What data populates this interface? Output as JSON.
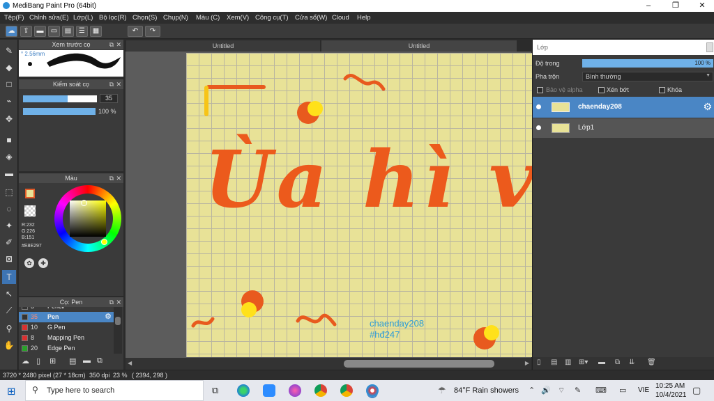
{
  "window": {
    "title": "MediBang Paint Pro (64bit)",
    "minimize": "–",
    "maximize": "❐",
    "close": "✕"
  },
  "menu": [
    "Tệp(F)",
    "Chỉnh sửa(E)",
    "Lớp(L)",
    "Bộ lọc(R)",
    "Chọn(S)",
    "Chụp(N)",
    "Màu (C)",
    "Xem(V)",
    "Công cụ(T)",
    "Cửa sổ(W)",
    "Cloud",
    "Help"
  ],
  "tabs": [
    "Untitled",
    "Untitled"
  ],
  "brush_preview": {
    "title": "Xem trước cọ",
    "size": "2.56mm"
  },
  "brush_control": {
    "title": "Kiểm soát cọ",
    "size_value": "35",
    "opacity_value": "100 %",
    "size_fraction": 0.35,
    "opacity_fraction": 1.0
  },
  "color": {
    "title": "Màu",
    "r": "R:232",
    "g": "G:226",
    "b": "B:151",
    "hex": "#E8E297",
    "swatch": "#e8e297",
    "primary": "#e8e297"
  },
  "brush_list": {
    "title": "Cọ: Pen",
    "items": [
      {
        "size": "3",
        "name": "Pencil",
        "color": "#333333"
      },
      {
        "size": "35",
        "name": "Pen",
        "color": "#333333",
        "selected": true
      },
      {
        "size": "10",
        "name": "G Pen",
        "color": "#d93030"
      },
      {
        "size": "8",
        "name": "Mapping Pen",
        "color": "#d93030"
      },
      {
        "size": "20",
        "name": "Edge Pen",
        "color": "#2aa02a"
      }
    ]
  },
  "layer_panel": {
    "title": "Lớp",
    "opacity_label": "Độ trong",
    "opacity_value": "100 %",
    "opacity_fraction": 1.0,
    "blend_label": "Pha trộn",
    "blend_value": "Bình thường",
    "protect_alpha": "Bảo vệ alpha",
    "clipping": "Xén bớt",
    "lock": "Khóa",
    "layers": [
      {
        "name": "chaenday208",
        "selected": true
      },
      {
        "name": "Lớp1",
        "selected": false
      }
    ]
  },
  "canvas": {
    "lettering": "Ùa hì vẹ",
    "signature": "chaenday208",
    "hashtag": "#hđ247"
  },
  "status": {
    "size": "3720 * 2480 pixel",
    "cm": "(27 * 18cm)",
    "dpi": "350 dpi",
    "zoom": "23 %",
    "coords": "( 2394, 298 )"
  },
  "taskbar": {
    "search_placeholder": "Type here to search",
    "weather": "84°F  Rain showers",
    "lang": "VIE",
    "time": "10:25 AM",
    "date": "10/4/2021"
  }
}
